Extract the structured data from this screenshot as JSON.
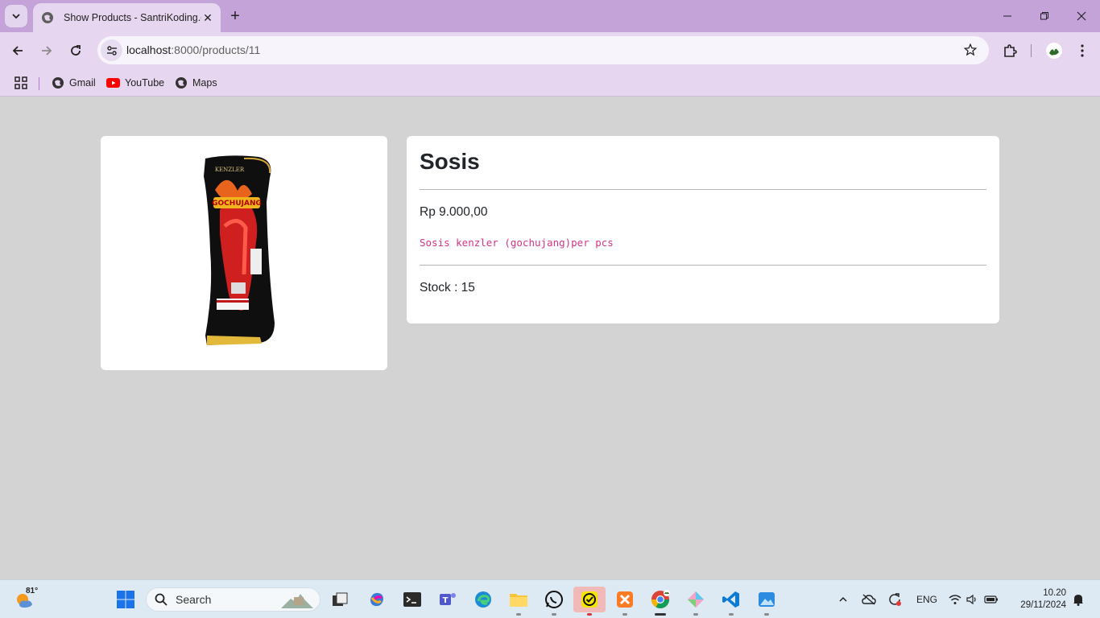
{
  "browser": {
    "tab_title": "Show Products - SantriKoding.c",
    "url_host": "localhost",
    "url_path": ":8000/products/11",
    "bookmarks": [
      {
        "label": "Gmail"
      },
      {
        "label": "YouTube"
      },
      {
        "label": "Maps"
      }
    ]
  },
  "product": {
    "title": "Sosis",
    "price": "Rp 9.000,00",
    "description": "Sosis kenzler (gochujang)per pcs",
    "stock": "Stock : 15",
    "image_text": "GOCHUJANG"
  },
  "taskbar": {
    "weather_temp": "81°",
    "search_placeholder": "Search",
    "language": "ENG",
    "time": "10.20",
    "date": "29/11/2024"
  },
  "colors": {
    "tab_bar": "#c4a3d8",
    "toolbar": "#e6d6ef",
    "page_bg": "#d3d3d3",
    "description_text": "#d63384"
  }
}
